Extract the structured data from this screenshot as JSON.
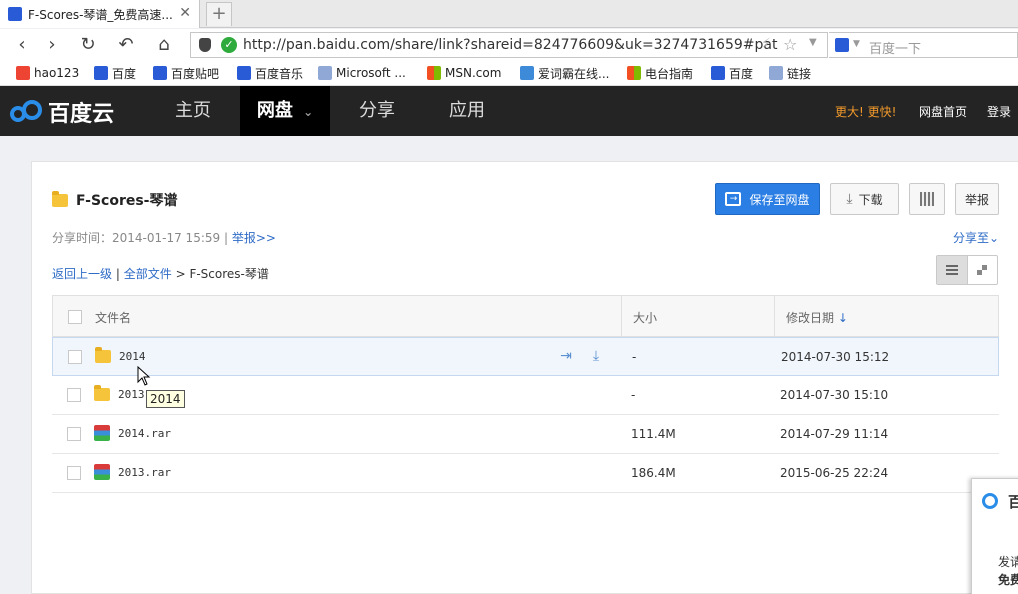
{
  "browser": {
    "tab_title": "F-Scores-琴谱_免费高速...",
    "tab_close": "✕",
    "new_tab": "+",
    "url": "http://pan.baidu.com/share/link?shareid=824776609&uk=3274731659#pat",
    "search_placeholder": "百度一下",
    "bookmarks": [
      "hao123",
      "百度",
      "百度贴吧",
      "百度音乐",
      "Microsoft ...",
      "MSN.com",
      "爱词霸在线...",
      "电台指南",
      "百度",
      "链接"
    ]
  },
  "header": {
    "logo_text": "百度云",
    "nav": [
      "主页",
      "网盘",
      "分享",
      "应用"
    ],
    "nav_active_arrow": "⌄",
    "promo_a": "更大",
    "promo_b": "更快",
    "promo_mark": "!",
    "home_link": "网盘首页",
    "login": "登录"
  },
  "share": {
    "folder_title": "F-Scores-琴谱",
    "share_time_label": "分享时间：2014-01-17 15:59",
    "sep": "|",
    "report_link": "举报>>",
    "save_button": "保存至网盘",
    "download_button": "下载",
    "report_button": "举报",
    "share_to": "分享至",
    "crumb_back": "返回上一级",
    "crumb_all": "全部文件",
    "crumb_sep": ">",
    "crumb_current": "F-Scores-琴谱"
  },
  "table": {
    "col_name": "文件名",
    "col_size": "大小",
    "col_date": "修改日期",
    "sort_arrow": "↓",
    "rows": [
      {
        "name": "2014",
        "type": "folder",
        "size": "-",
        "date": "2014-07-30 15:12"
      },
      {
        "name": "2013",
        "type": "folder",
        "size": "-",
        "date": "2014-07-30 15:10"
      },
      {
        "name": "2014.rar",
        "type": "rar",
        "size": "111.4M",
        "date": "2014-07-29 11:14"
      },
      {
        "name": "2013.rar",
        "type": "rar",
        "size": "186.4M",
        "date": "2015-06-25 22:24"
      }
    ]
  },
  "tooltip": "2014",
  "popup": {
    "title_char": "百",
    "line1": "发请",
    "line2": "免费"
  }
}
